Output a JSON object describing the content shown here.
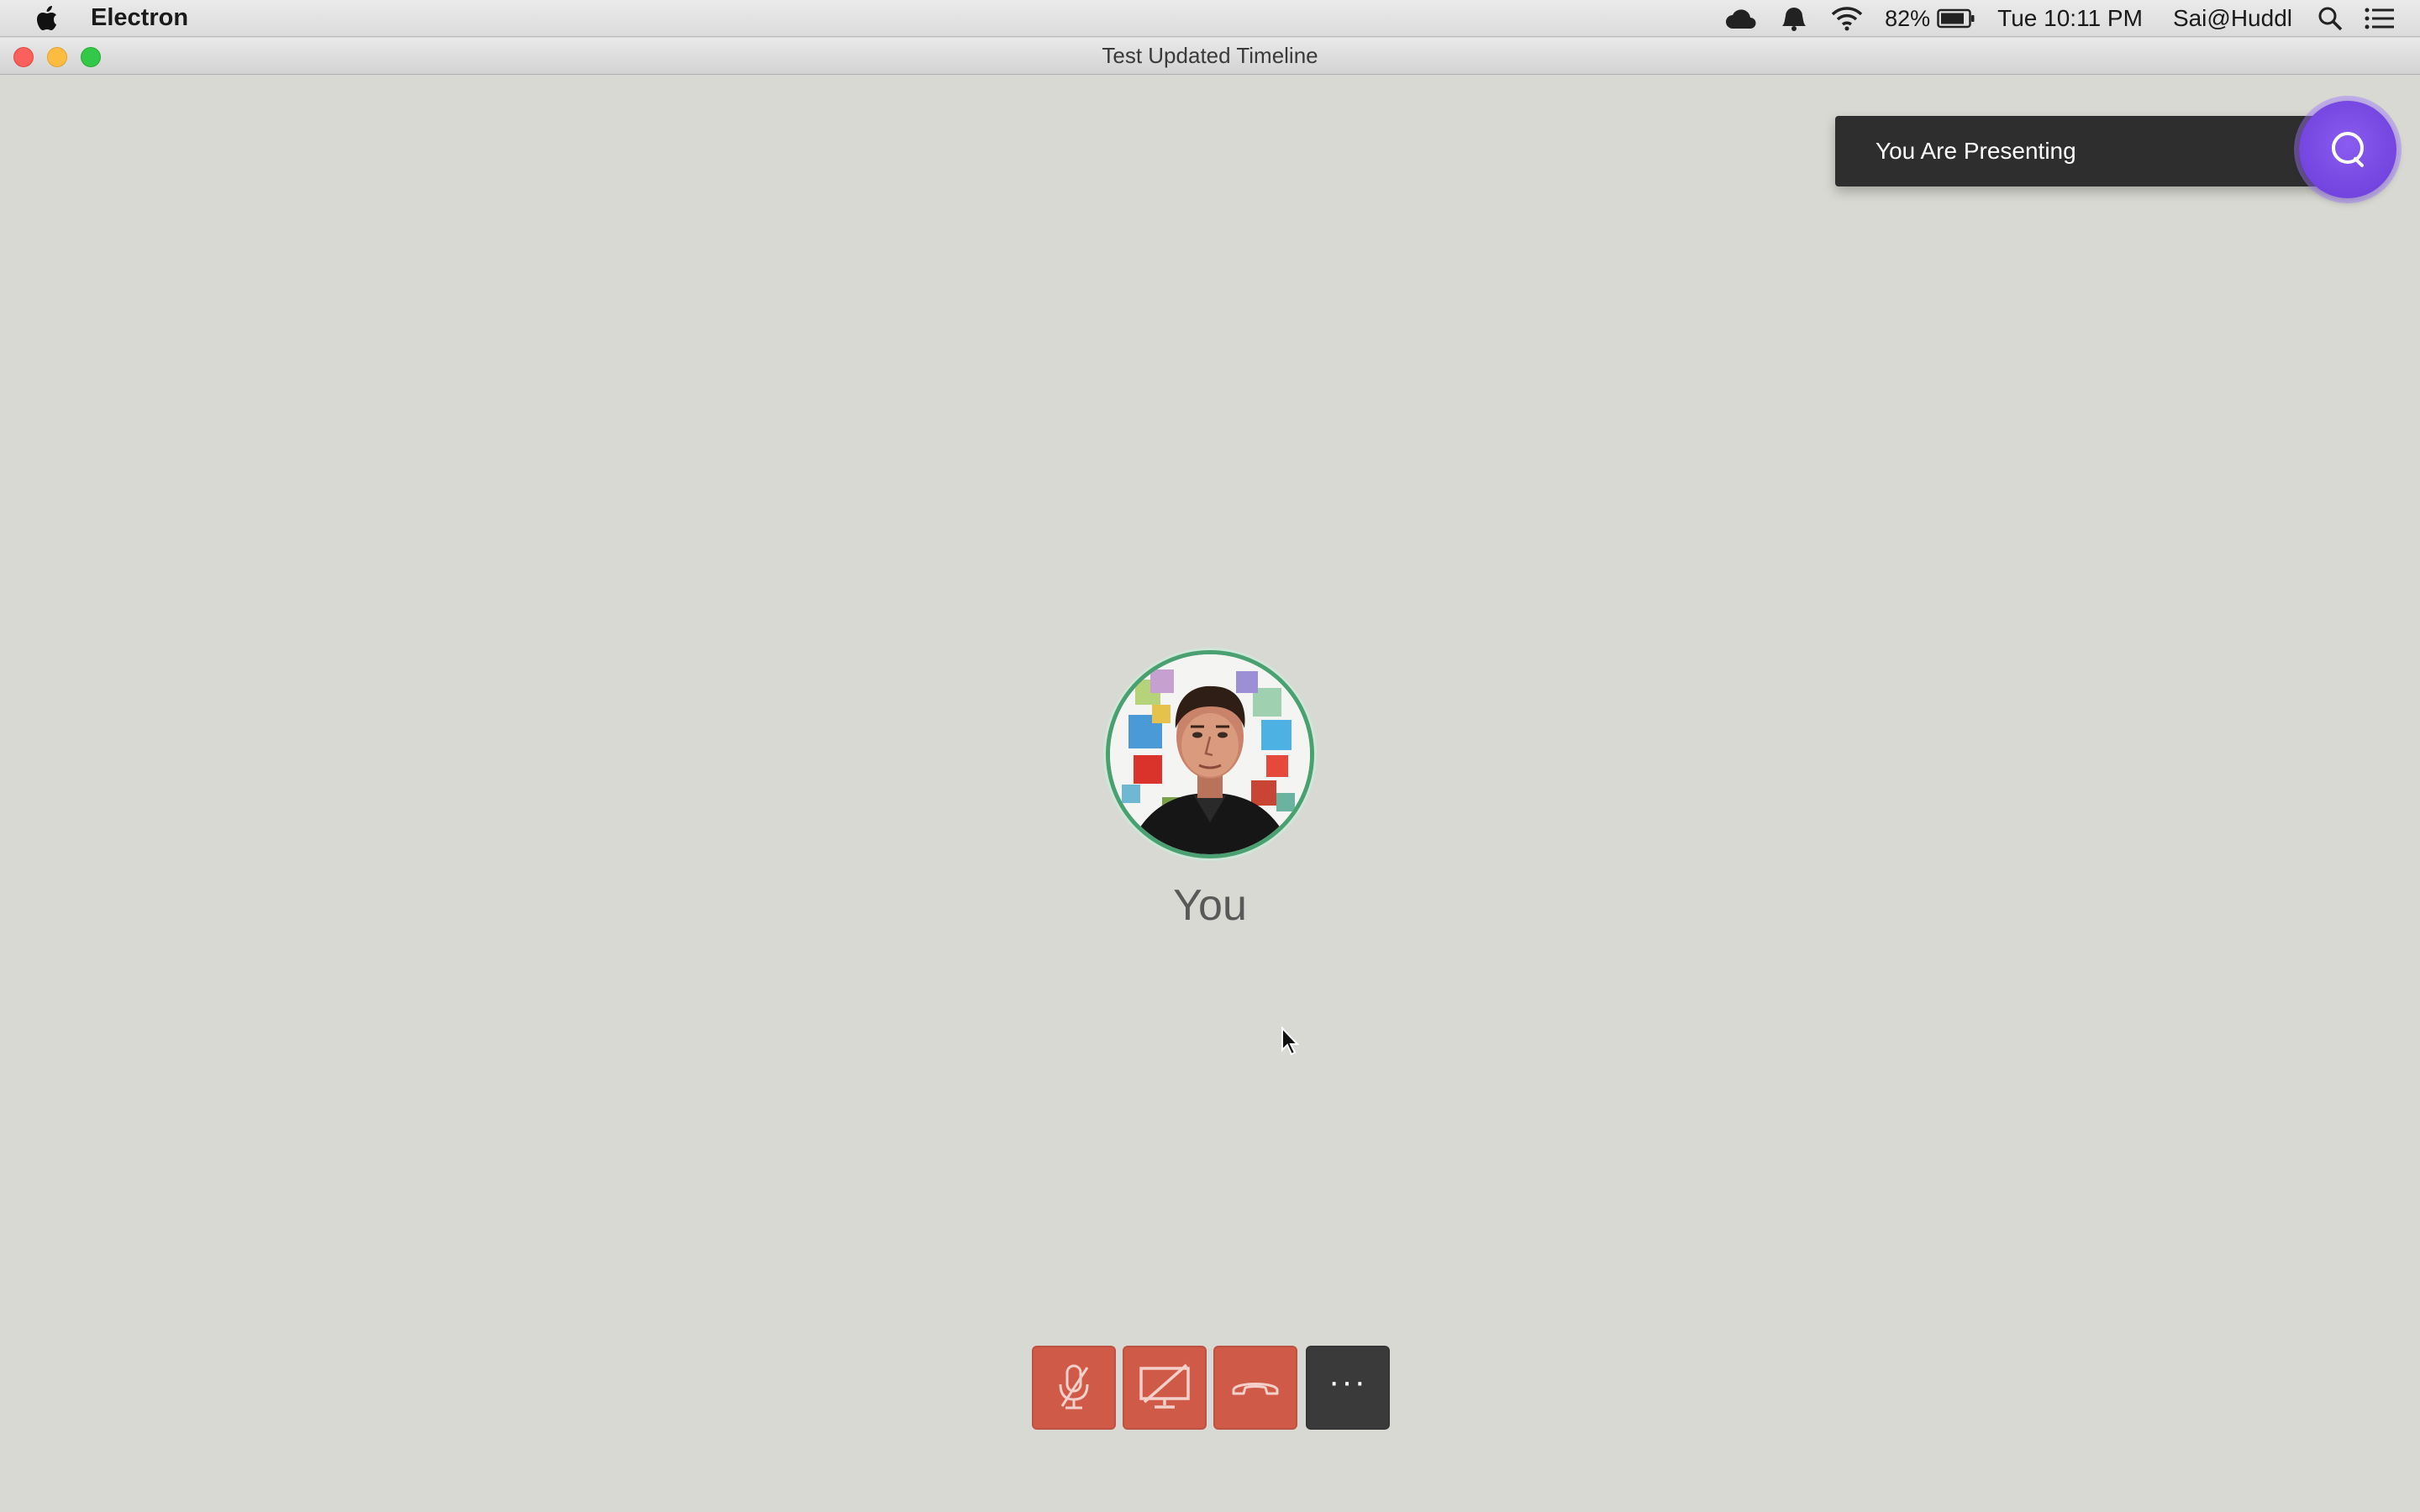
{
  "menubar": {
    "app_name": "Electron",
    "battery_percent": "82%",
    "clock": "Tue 10:11 PM",
    "user": "Sai@Huddl",
    "icons": [
      "apple-icon",
      "cloud-icon",
      "bell-icon",
      "wifi-icon",
      "battery-icon",
      "spotlight-search-icon",
      "notification-center-icon"
    ]
  },
  "window": {
    "title": "Test Updated Timeline"
  },
  "toast": {
    "message": "You Are Presenting",
    "icon": "presenting-icon",
    "accent_color": "#7b4be6"
  },
  "participant": {
    "label": "You",
    "ring_color": "#4aa070"
  },
  "controls": {
    "items": [
      {
        "name": "mute-mic-button",
        "icon": "mic-off-icon",
        "state": "off"
      },
      {
        "name": "stop-screen-share-button",
        "icon": "screen-share-off-icon",
        "state": "off"
      },
      {
        "name": "end-call-button",
        "icon": "hang-up-icon"
      },
      {
        "name": "more-options-button",
        "icon": "more-icon",
        "label": "···"
      }
    ],
    "danger_color": "#cf5a48",
    "neutral_color": "#3a3a3a"
  }
}
